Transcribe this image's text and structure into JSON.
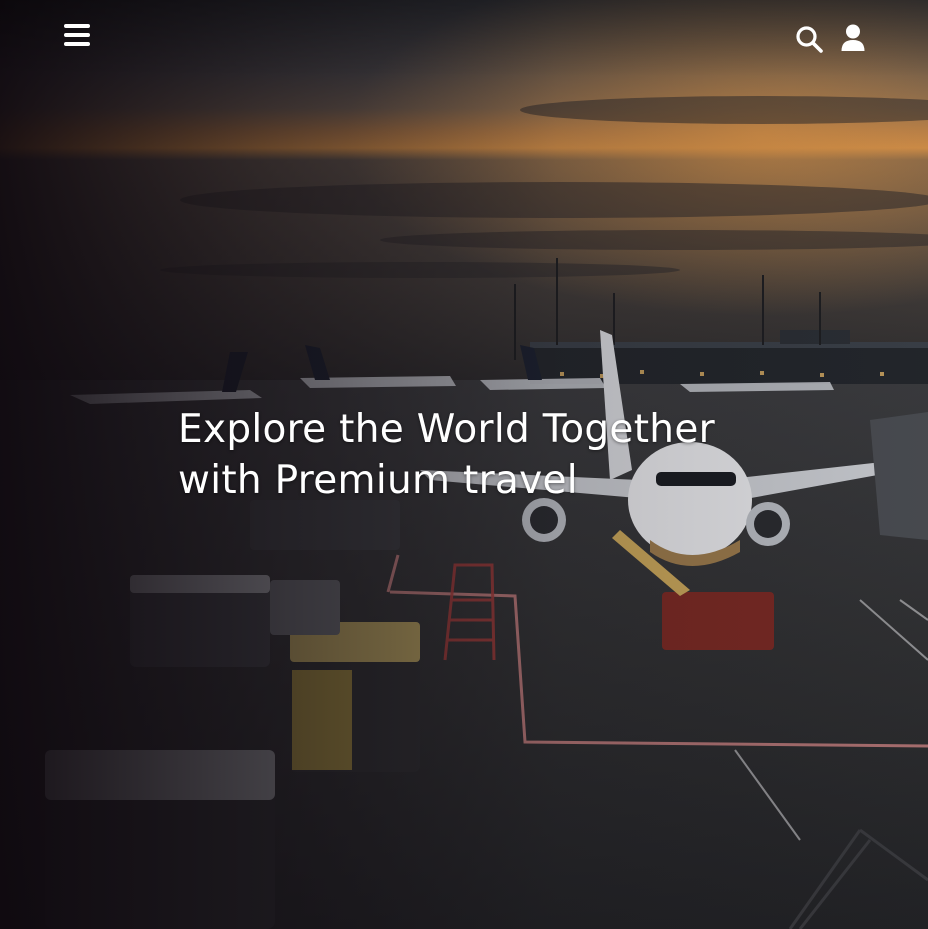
{
  "header": {
    "menu_icon": "hamburger-menu-icon",
    "search_icon": "search-icon",
    "user_icon": "user-icon"
  },
  "hero": {
    "headline_line1": "Explore the World Together",
    "headline_line2": "with Premium travel",
    "background": "airport apron at sunset with parked airliners"
  },
  "colors": {
    "text": "#ffffff",
    "overlay": "#0e080e",
    "sky_glow": "#d98a3a"
  }
}
